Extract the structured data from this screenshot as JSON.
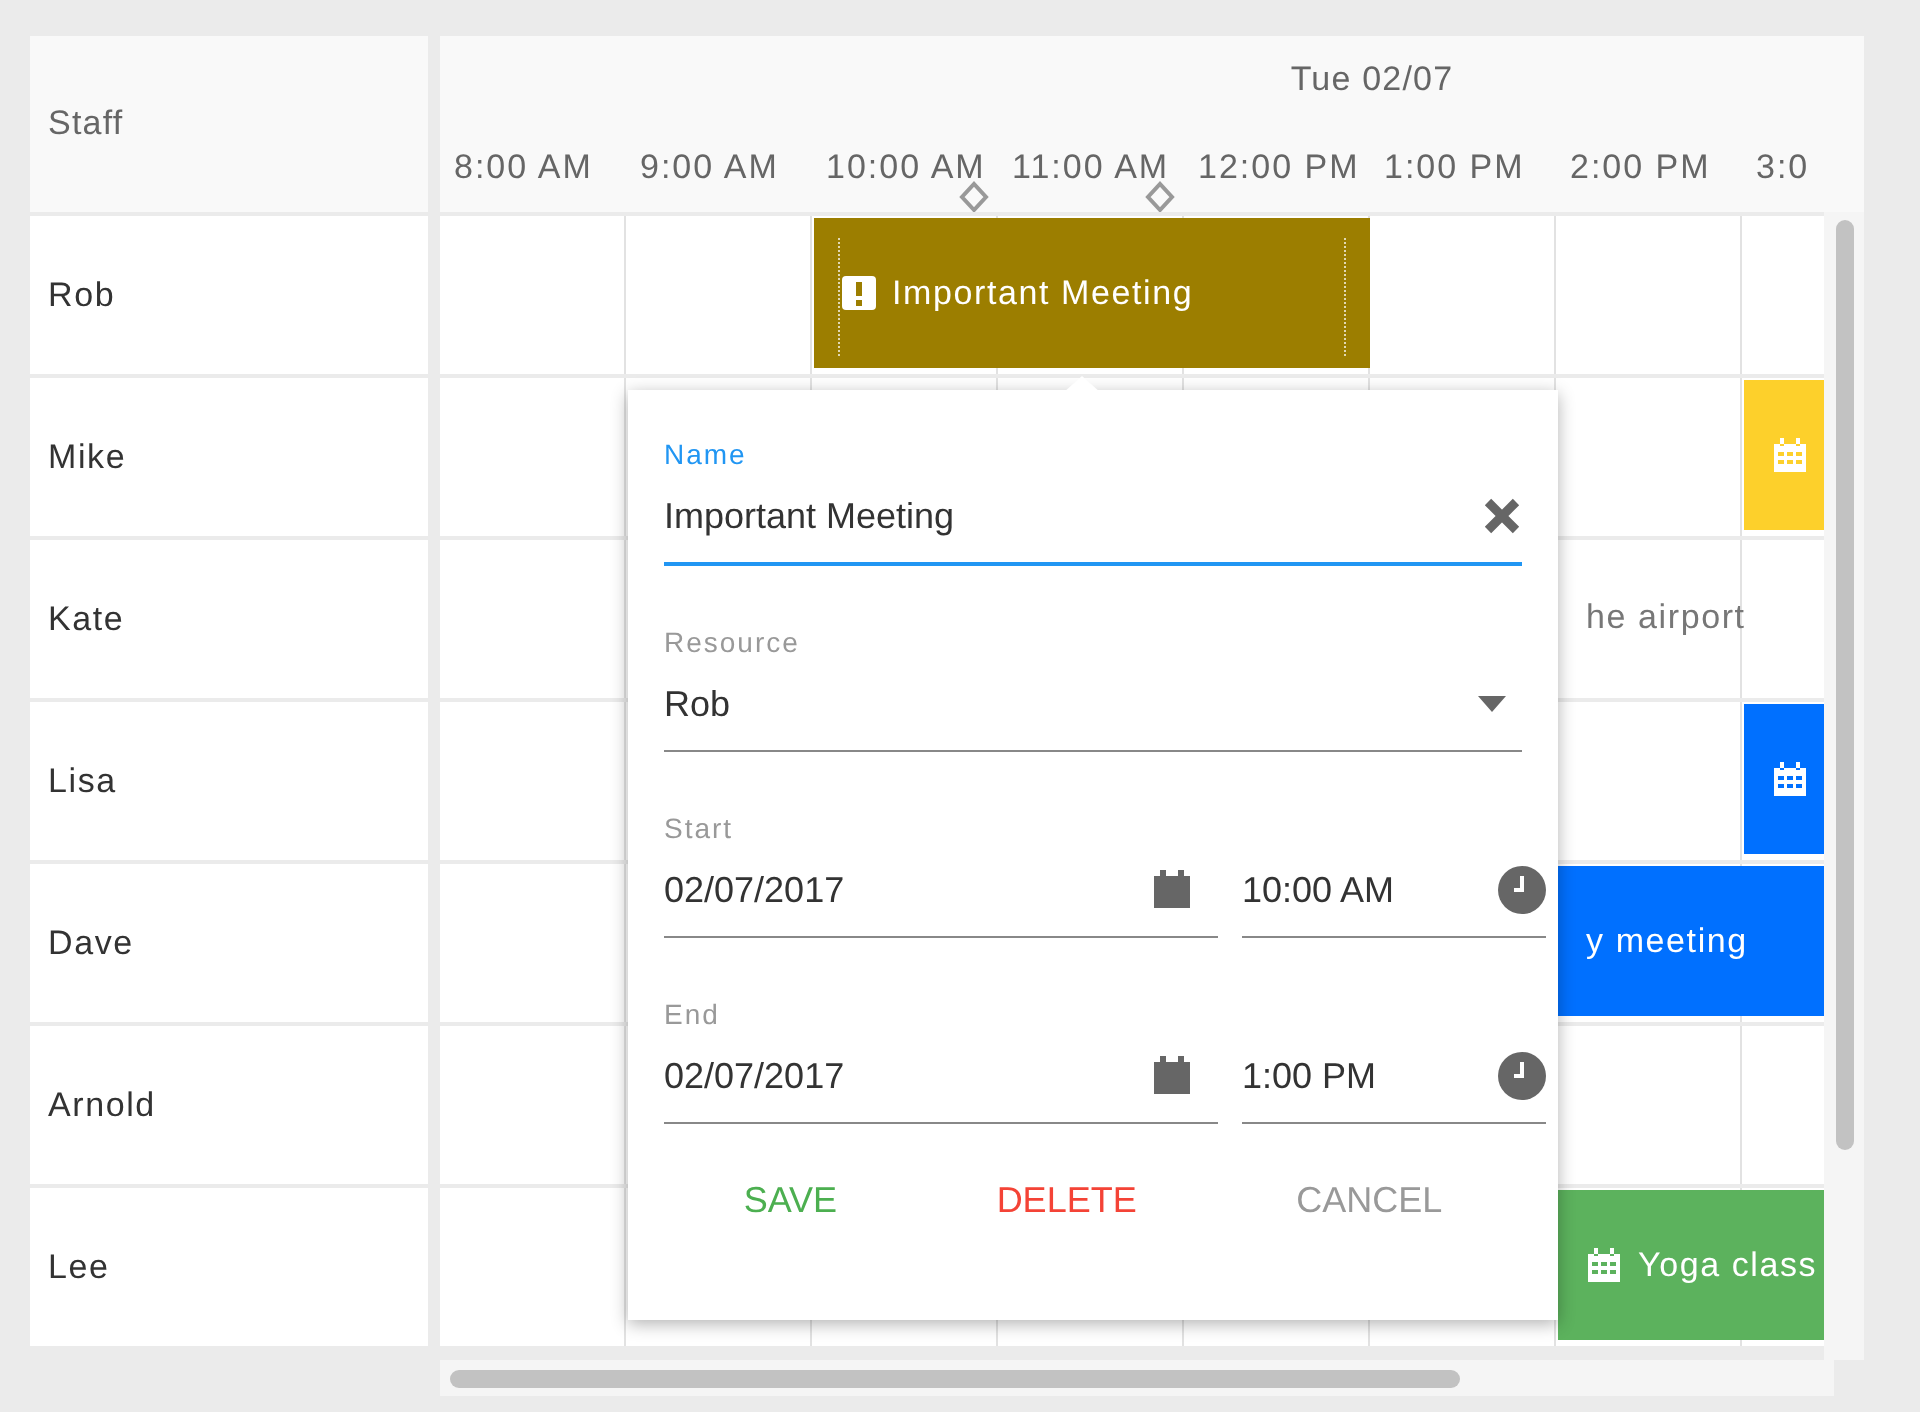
{
  "staff_header": "Staff",
  "date_header": "Tue 02/07",
  "times": [
    "8:00 AM",
    "9:00 AM",
    "10:00 AM",
    "11:00 AM",
    "12:00 PM",
    "1:00 PM",
    "2:00 PM",
    "3:0"
  ],
  "staff": [
    {
      "name": "Rob",
      "events": [
        {
          "kind": "alert",
          "text": "Important Meeting",
          "color": "#9c7e00",
          "selected": true
        }
      ]
    },
    {
      "name": "Mike",
      "events": [
        {
          "kind": "calendar",
          "color": "#fdd02b",
          "selected": false
        }
      ]
    },
    {
      "name": "Kate",
      "events": [
        {
          "kind": "plain",
          "text": "he airport",
          "selected": false
        }
      ]
    },
    {
      "name": "Lisa",
      "events": [
        {
          "kind": "calendar",
          "color": "#0070ff",
          "selected": false
        }
      ]
    },
    {
      "name": "Dave",
      "events": [
        {
          "kind": "bar",
          "text": "y meeting",
          "color": "#0070ff",
          "selected": false
        }
      ]
    },
    {
      "name": "Arnold"
    },
    {
      "name": "Lee",
      "events": [
        {
          "kind": "calendar",
          "text": "Yoga class",
          "color": "#5cb25d",
          "selected": false
        }
      ]
    }
  ],
  "dialog": {
    "name_label": "Name",
    "name_value": "Important Meeting",
    "resource_label": "Resource",
    "resource_value": "Rob",
    "start_label": "Start",
    "start_date": "02/07/2017",
    "start_time": "10:00 AM",
    "end_label": "End",
    "end_date": "02/07/2017",
    "end_time": "1:00 PM",
    "buttons": [
      {
        "kind": "save",
        "label": "SAVE"
      },
      {
        "kind": "delete",
        "label": "DELETE"
      },
      {
        "kind": "cancel",
        "label": "CANCEL"
      }
    ]
  }
}
